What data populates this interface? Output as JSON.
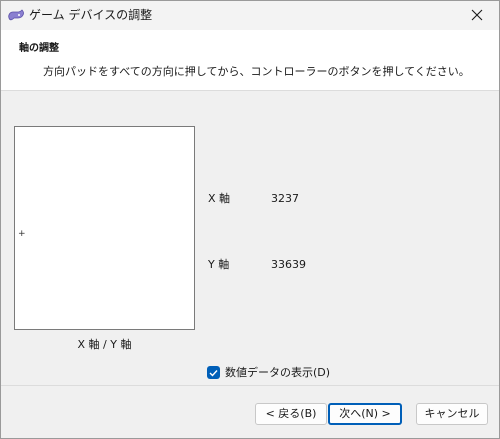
{
  "window": {
    "title": "ゲーム デバイスの調整",
    "app_icon": "game-controller-icon",
    "close_icon": "close-icon"
  },
  "header": {
    "title": "軸の調整",
    "description": "方向パッドをすべての方向に押してから、コントローラーのボタンを押してください。"
  },
  "xy_panel": {
    "caption": "X 軸 / Y 軸",
    "crosshair": "+"
  },
  "axes": [
    {
      "label": "X 軸",
      "value": "3237"
    },
    {
      "label": "Y 軸",
      "value": "33639"
    }
  ],
  "show_values": {
    "label": "数値データの表示(D)",
    "checked": true
  },
  "buttons": {
    "back": "< 戻る(B)",
    "next": "次へ(N) >",
    "cancel": "キャンセル"
  },
  "colors": {
    "accent": "#005fb8",
    "header_bg": "#ffffff",
    "dialog_bg": "#f0f0f0"
  }
}
